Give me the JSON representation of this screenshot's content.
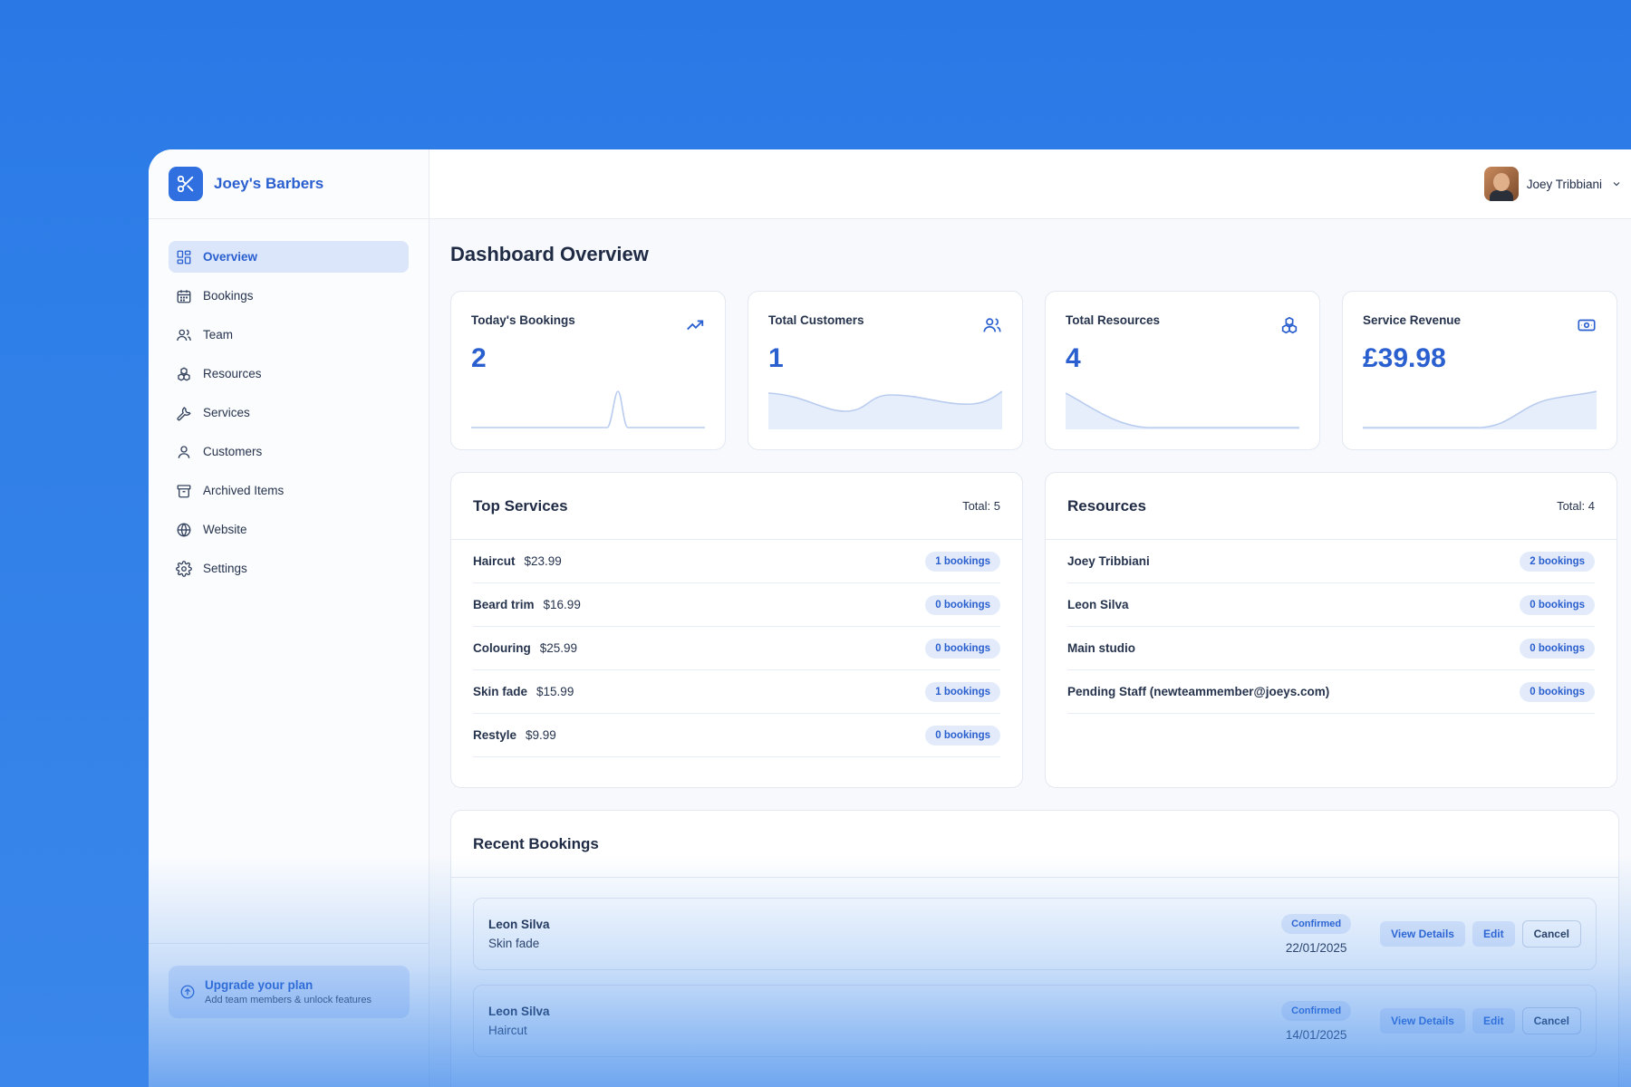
{
  "brand": {
    "name": "Joey's Barbers",
    "icon": "scissors-icon"
  },
  "user": {
    "name": "Joey Tribbiani"
  },
  "sidebar": {
    "items": [
      {
        "label": "Overview",
        "icon": "dashboard-icon",
        "active": true
      },
      {
        "label": "Bookings",
        "icon": "calendar-icon"
      },
      {
        "label": "Team",
        "icon": "users-icon"
      },
      {
        "label": "Resources",
        "icon": "cubes-icon"
      },
      {
        "label": "Services",
        "icon": "wrench-icon"
      },
      {
        "label": "Customers",
        "icon": "user-icon"
      },
      {
        "label": "Archived Items",
        "icon": "archive-icon"
      },
      {
        "label": "Website",
        "icon": "globe-icon"
      },
      {
        "label": "Settings",
        "icon": "gear-icon"
      }
    ],
    "upgrade": {
      "title": "Upgrade your plan",
      "subtitle": "Add team members & unlock features"
    }
  },
  "page": {
    "title": "Dashboard Overview"
  },
  "stats": [
    {
      "label": "Today's Bookings",
      "value": "2",
      "icon": "trending-up-icon"
    },
    {
      "label": "Total Customers",
      "value": "1",
      "icon": "users-icon"
    },
    {
      "label": "Total Resources",
      "value": "4",
      "icon": "cubes-icon"
    },
    {
      "label": "Service Revenue",
      "value": "£39.98",
      "icon": "cash-icon"
    }
  ],
  "top_services": {
    "title": "Top Services",
    "total": "Total: 5",
    "rows": [
      {
        "name": "Haircut",
        "price": "$23.99",
        "bookings": "1 bookings"
      },
      {
        "name": "Beard trim",
        "price": "$16.99",
        "bookings": "0 bookings"
      },
      {
        "name": "Colouring",
        "price": "$25.99",
        "bookings": "0 bookings"
      },
      {
        "name": "Skin fade",
        "price": "$15.99",
        "bookings": "1 bookings"
      },
      {
        "name": "Restyle",
        "price": "$9.99",
        "bookings": "0 bookings"
      }
    ]
  },
  "resources": {
    "title": "Resources",
    "total": "Total: 4",
    "rows": [
      {
        "name": "Joey Tribbiani",
        "bookings": "2 bookings"
      },
      {
        "name": "Leon Silva",
        "bookings": "0 bookings"
      },
      {
        "name": "Main studio",
        "bookings": "0 bookings"
      },
      {
        "name": "Pending Staff (newteammember@joeys.com)",
        "bookings": "0 bookings"
      }
    ]
  },
  "recent_bookings": {
    "title": "Recent Bookings",
    "items": [
      {
        "customer": "Leon Silva",
        "service": "Skin fade",
        "status": "Confirmed",
        "date": "22/01/2025"
      },
      {
        "customer": "Leon Silva",
        "service": "Haircut",
        "status": "Confirmed",
        "date": "14/01/2025"
      }
    ],
    "actions": {
      "view": "View Details",
      "edit": "Edit",
      "cancel": "Cancel"
    }
  },
  "colors": {
    "accent": "#2a5fcf",
    "background": "#2f7fe8",
    "pill": "#e3ebfb"
  }
}
